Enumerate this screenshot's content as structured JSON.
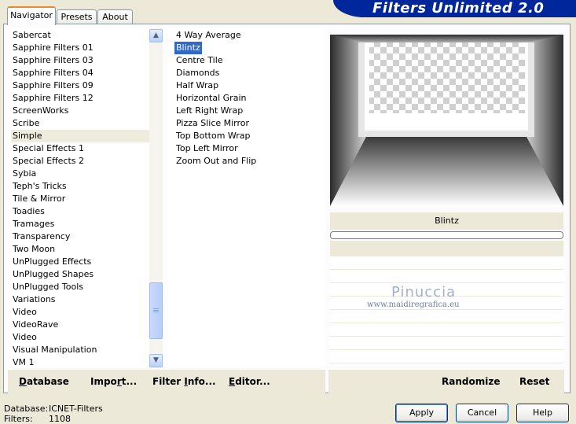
{
  "tabs": [
    {
      "label": "Navigator",
      "active": true
    },
    {
      "label": "Presets",
      "active": false
    },
    {
      "label": "About",
      "active": false
    }
  ],
  "banner": {
    "title": "Filters Unlimited 2.0",
    "color": "#00269c"
  },
  "categories": {
    "items": [
      "Sabercat",
      "Sapphire Filters 01",
      "Sapphire Filters 03",
      "Sapphire Filters 04",
      "Sapphire Filters 09",
      "Sapphire Filters 12",
      "ScreenWorks",
      "Scribe",
      "Simple",
      "Special Effects 1",
      "Special Effects 2",
      "Sybia",
      "Teph's Tricks",
      "Tile & Mirror",
      "Toadies",
      "Tramages",
      "Transparency",
      "Two Moon",
      "UnPlugged Effects",
      "UnPlugged Shapes",
      "UnPlugged Tools",
      "Variations",
      "Video",
      "VideoRave",
      "Video",
      "Visual Manipulation",
      "VM 1"
    ],
    "selected": "Simple"
  },
  "filters": {
    "items": [
      "4 Way Average",
      "Blintz",
      "Centre Tile",
      "Diamonds",
      "Half Wrap",
      "Horizontal Grain",
      "Left Right Wrap",
      "Pizza Slice Mirror",
      "Top Bottom Wrap",
      "Top Left Mirror",
      "Zoom Out and Flip"
    ],
    "selected": "Blintz"
  },
  "left_buttons": {
    "database": "Database",
    "import": "Import...",
    "filter_info": "Filter Info...",
    "editor": "Editor..."
  },
  "right_buttons": {
    "randomize": "Randomize",
    "reset": "Reset"
  },
  "preview": {
    "filter_name": "Blintz"
  },
  "watermark": {
    "name": "Pinuccia",
    "url": "www.maidiregrafica.eu"
  },
  "footer": {
    "database_label": "Database:",
    "database_value": "ICNET-Filters",
    "filters_label": "Filters:",
    "filters_value": "1108"
  },
  "dialog_buttons": {
    "apply": "Apply",
    "cancel": "Cancel",
    "help": "Help"
  }
}
